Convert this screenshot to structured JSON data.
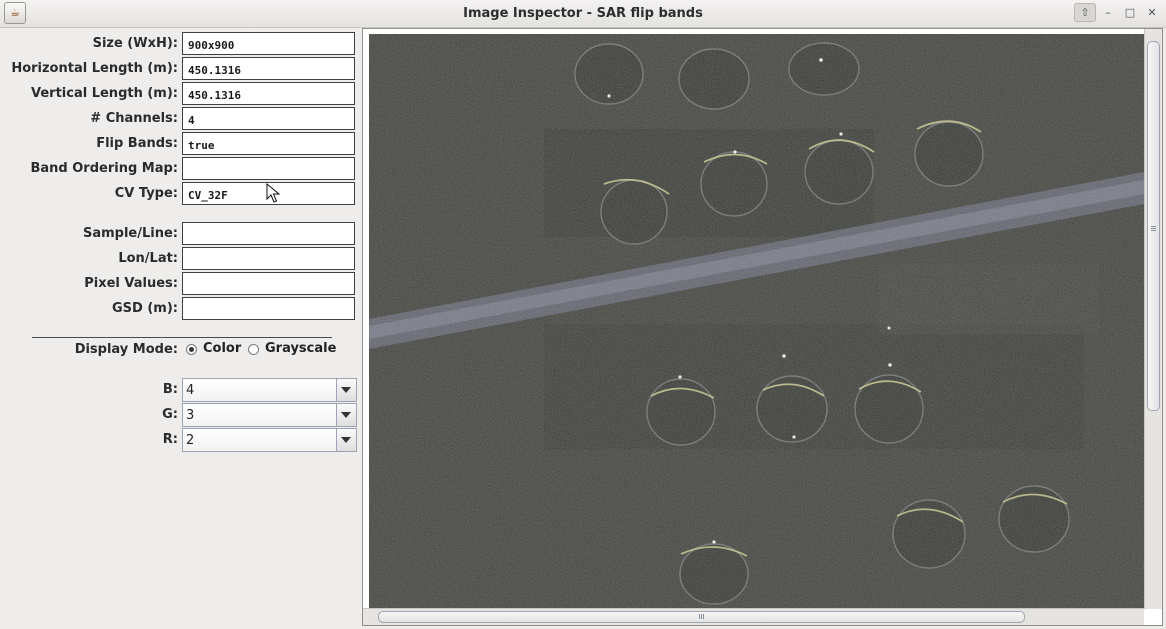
{
  "window": {
    "title": "Image Inspector - SAR flip bands",
    "app_icon": "java-cup-icon",
    "controls": [
      "up-icon",
      "minimize-icon",
      "maximize-icon",
      "close-icon"
    ]
  },
  "info": {
    "size": {
      "label": "Size (WxH):",
      "value": "900x900"
    },
    "h_length": {
      "label": "Horizontal Length (m):",
      "value": "450.1316"
    },
    "v_length": {
      "label": "Vertical Length (m):",
      "value": "450.1316"
    },
    "channels": {
      "label": "# Channels:",
      "value": "4"
    },
    "flip": {
      "label": "Flip Bands:",
      "value": "true"
    },
    "band_map": {
      "label": "Band Ordering Map:",
      "value": ""
    },
    "cv_type": {
      "label": "CV Type:",
      "value": "CV_32F"
    }
  },
  "probe": {
    "sample_line": {
      "label": "Sample/Line:",
      "value": ""
    },
    "lonlat": {
      "label": "Lon/Lat:",
      "value": ""
    },
    "pixel": {
      "label": "Pixel Values:",
      "value": ""
    },
    "gsd": {
      "label": "GSD (m):",
      "value": ""
    }
  },
  "display": {
    "label": "Display Mode:",
    "color": "Color",
    "grayscale": "Grayscale",
    "selected": "Color"
  },
  "bands": {
    "b": {
      "label": "B:",
      "value": "4"
    },
    "g": {
      "label": "G:",
      "value": "3"
    },
    "r": {
      "label": "R:",
      "value": "2"
    }
  },
  "colors": {
    "background": "#eeedeb",
    "sar_base": "#3b3c37",
    "border": "#404040"
  }
}
